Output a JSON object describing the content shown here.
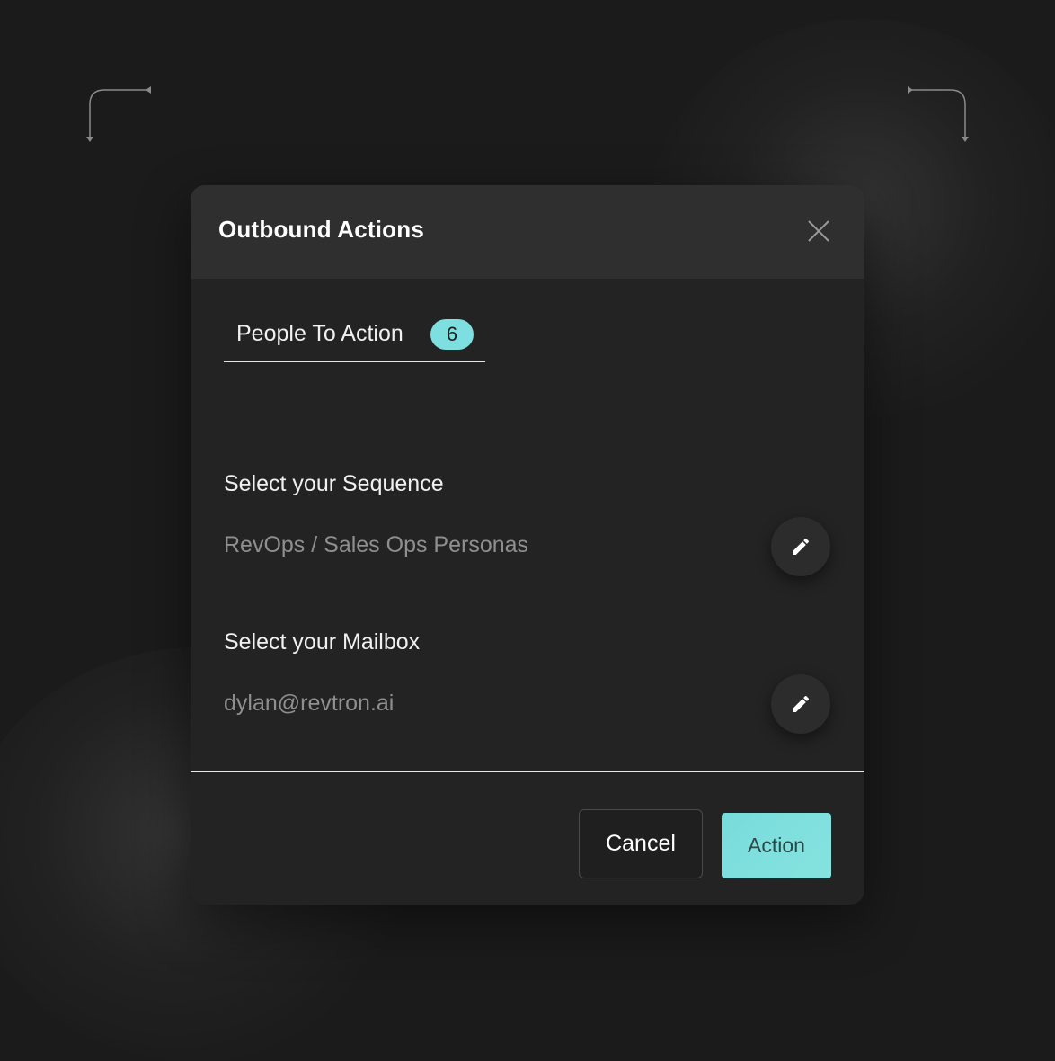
{
  "dialog": {
    "title": "Outbound Actions",
    "close_icon": "close-icon"
  },
  "tab": {
    "label": "People To Action",
    "count": "6"
  },
  "sequence": {
    "label": "Select your Sequence",
    "value": "RevOps / Sales Ops Personas",
    "edit_icon": "pencil-icon"
  },
  "mailbox": {
    "label": "Select your Mailbox",
    "value": "dylan@revtron.ai",
    "edit_icon": "pencil-icon"
  },
  "footer": {
    "cancel_label": "Cancel",
    "action_label": "Action"
  },
  "colors": {
    "accent": "#7ddfdf",
    "background": "#1b1b1b",
    "dialog": "#232323",
    "header": "#2f2f2f"
  }
}
